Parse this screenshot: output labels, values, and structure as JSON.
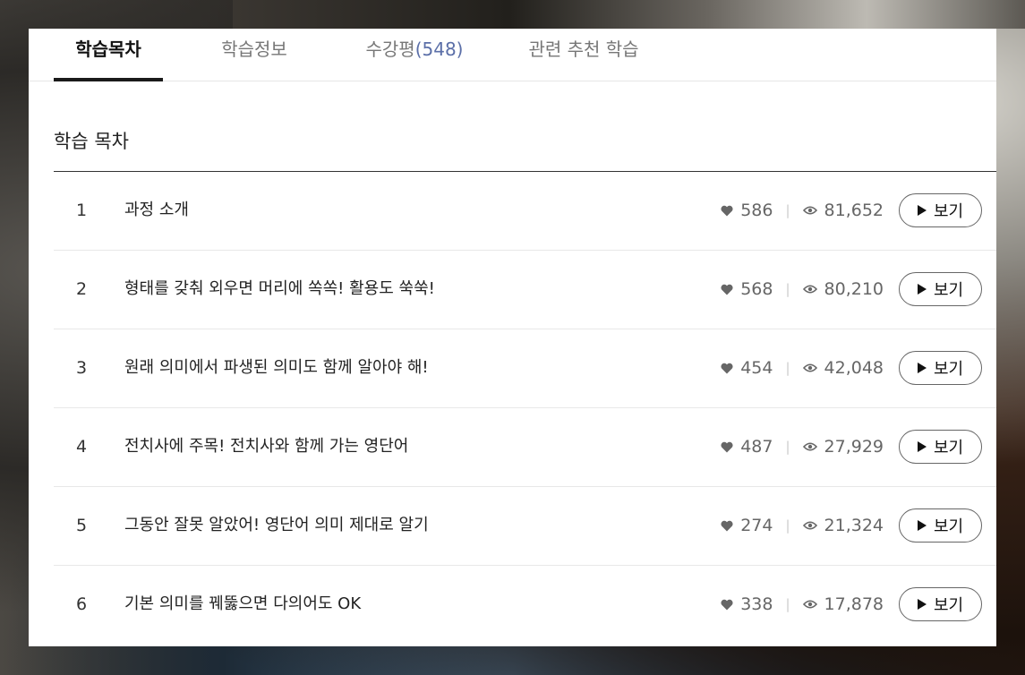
{
  "tabs": [
    {
      "label": "학습목차",
      "active": true
    },
    {
      "label": "학습정보",
      "active": false
    },
    {
      "label": "수강평",
      "count": "(548)",
      "active": false
    },
    {
      "label": "관련 추천 학습",
      "active": false
    }
  ],
  "section_title": "학습 목차",
  "colors": {
    "accent": "#1a1a1a",
    "count": "#5b6fa8"
  },
  "icons": {
    "like": "heart-icon",
    "views": "eye-icon",
    "play": "play-icon"
  },
  "rows": [
    {
      "num": "1",
      "title": "과정 소개",
      "likes": "586",
      "views": "81,652",
      "button": "보기"
    },
    {
      "num": "2",
      "title": "형태를 갖춰 외우면 머리에 쏙쏙! 활용도 쑥쑥!",
      "likes": "568",
      "views": "80,210",
      "button": "보기"
    },
    {
      "num": "3",
      "title": "원래 의미에서 파생된 의미도 함께 알아야 해!",
      "likes": "454",
      "views": "42,048",
      "button": "보기"
    },
    {
      "num": "4",
      "title": "전치사에 주목! 전치사와 함께 가는 영단어",
      "likes": "487",
      "views": "27,929",
      "button": "보기"
    },
    {
      "num": "5",
      "title": "그동안 잘못 알았어! 영단어 의미 제대로 알기",
      "likes": "274",
      "views": "21,324",
      "button": "보기"
    },
    {
      "num": "6",
      "title": "기본 의미를 꿰뚫으면 다의어도 OK",
      "likes": "338",
      "views": "17,878",
      "button": "보기"
    }
  ]
}
